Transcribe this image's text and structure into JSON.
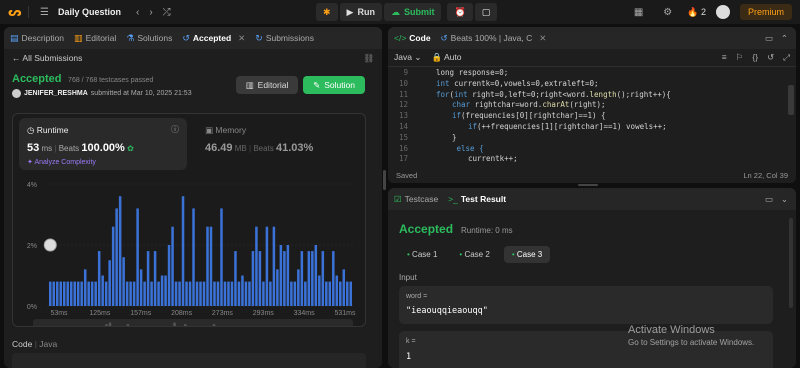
{
  "topbar": {
    "title": "Daily Question",
    "run_label": "Run",
    "submit_label": "Submit",
    "streak_count": "2",
    "premium_label": "Premium"
  },
  "left_tabs": [
    "Description",
    "Editorial",
    "Solutions",
    "Accepted",
    "Submissions"
  ],
  "submission": {
    "back_label": "All Submissions",
    "status": "Accepted",
    "testcases": "768 / 768 testcases passed",
    "user": "JENIFER_RESHMA",
    "submitted_at": "submitted at Mar 10, 2025 21:53",
    "editorial_btn": "Editorial",
    "solution_btn": "Solution",
    "runtime_label": "Runtime",
    "runtime_value": "53",
    "runtime_unit": "ms",
    "beats_label": "Beats",
    "runtime_beats": "100.00%",
    "analyze_label": "Analyze Complexity",
    "memory_label": "Memory",
    "memory_value": "46.49",
    "memory_unit": "MB",
    "memory_beats": "41.03%",
    "code_label": "Code",
    "code_lang": "Java"
  },
  "chart_data": {
    "type": "bar",
    "ylabel": "",
    "y_ticks": [
      "4%",
      "2%",
      "0%"
    ],
    "ylim": [
      0,
      4
    ],
    "x_ticks": [
      "53ms",
      "125ms",
      "157ms",
      "208ms",
      "273ms",
      "293ms",
      "334ms",
      "531ms"
    ],
    "values": [
      0.8,
      0.8,
      0.8,
      0.8,
      0.8,
      0.8,
      0.8,
      0.8,
      0.8,
      0.8,
      1.2,
      0.8,
      0.8,
      0.8,
      1.8,
      1.0,
      0.8,
      1.5,
      2.6,
      3.2,
      3.6,
      1.6,
      0.8,
      0.8,
      0.8,
      3.2,
      1.2,
      0.8,
      1.8,
      0.8,
      1.8,
      0.8,
      1.0,
      1.0,
      2.0,
      2.6,
      0.8,
      0.8,
      3.6,
      0.8,
      0.8,
      3.2,
      0.8,
      0.8,
      0.8,
      2.6,
      2.6,
      0.8,
      0.8,
      3.2,
      0.8,
      0.8,
      0.8,
      1.8,
      0.8,
      1.0,
      0.8,
      0.8,
      1.8,
      2.6,
      1.8,
      0.8,
      2.6,
      0.8,
      2.6,
      1.2,
      2.0,
      1.8,
      2.0,
      0.8,
      0.8,
      1.2,
      1.8,
      0.8,
      1.8,
      1.8,
      2.0,
      1.0,
      1.8,
      0.8,
      0.8,
      1.8,
      1.0,
      0.8,
      1.2,
      0.8,
      0.8
    ],
    "mini_ticks": [
      "53ms",
      "157ms",
      "273ms",
      "334ms"
    ]
  },
  "editor": {
    "tab_code": "Code",
    "tab_file": "Beats 100% | Java, C",
    "lang": "Java",
    "auto_label": "Auto",
    "status_left": "Saved",
    "status_right": "Ln 22, Col 39",
    "lines": [
      {
        "n": "9",
        "indent": 0,
        "tokens": [
          [
            "long response=0;",
            "plain"
          ]
        ]
      },
      {
        "n": "10",
        "indent": 0,
        "tokens": [
          [
            "int ",
            "kw"
          ],
          [
            "currentk=0,vowels=0,extraleft=0;",
            "plain"
          ]
        ]
      },
      {
        "n": "11",
        "indent": 0,
        "tokens": [
          [
            "for",
            "kw"
          ],
          [
            "(",
            "plain"
          ],
          [
            "int ",
            "kw"
          ],
          [
            "right=0,left=0;right<word.",
            "plain"
          ],
          [
            "length",
            "fn"
          ],
          [
            "();right++){",
            "plain"
          ]
        ]
      },
      {
        "n": "12",
        "indent": 1,
        "tokens": [
          [
            "char ",
            "kw"
          ],
          [
            "rightchar=word.",
            "plain"
          ],
          [
            "charAt",
            "fn"
          ],
          [
            "(right);",
            "plain"
          ]
        ]
      },
      {
        "n": "13",
        "indent": 1,
        "tokens": [
          [
            "if",
            "kw"
          ],
          [
            "(frequencies[0][rightchar]==1) {",
            "plain"
          ]
        ]
      },
      {
        "n": "14",
        "indent": 2,
        "tokens": [
          [
            "if",
            "kw"
          ],
          [
            "(++frequencies[1][rightchar]==1) vowels++;",
            "plain"
          ]
        ]
      },
      {
        "n": "15",
        "indent": 1,
        "tokens": [
          [
            "}",
            "plain"
          ]
        ]
      },
      {
        "n": "16",
        "indent": 1,
        "tokens": [
          [
            " else {",
            "kw"
          ]
        ]
      },
      {
        "n": "17",
        "indent": 2,
        "tokens": [
          [
            "currentk++;",
            "plain"
          ]
        ]
      }
    ]
  },
  "testpanel": {
    "tab_testcase": "Testcase",
    "tab_result": "Test Result",
    "status": "Accepted",
    "runtime": "Runtime: 0 ms",
    "cases": [
      "Case 1",
      "Case 2",
      "Case 3"
    ],
    "input_label": "Input",
    "word_label": "word =",
    "word_value": "\"ieaouqqieaouqq\"",
    "k_label": "k =",
    "k_value": "1"
  },
  "watermark": {
    "title": "Activate Windows",
    "subtitle": "Go to Settings to activate Windows."
  }
}
